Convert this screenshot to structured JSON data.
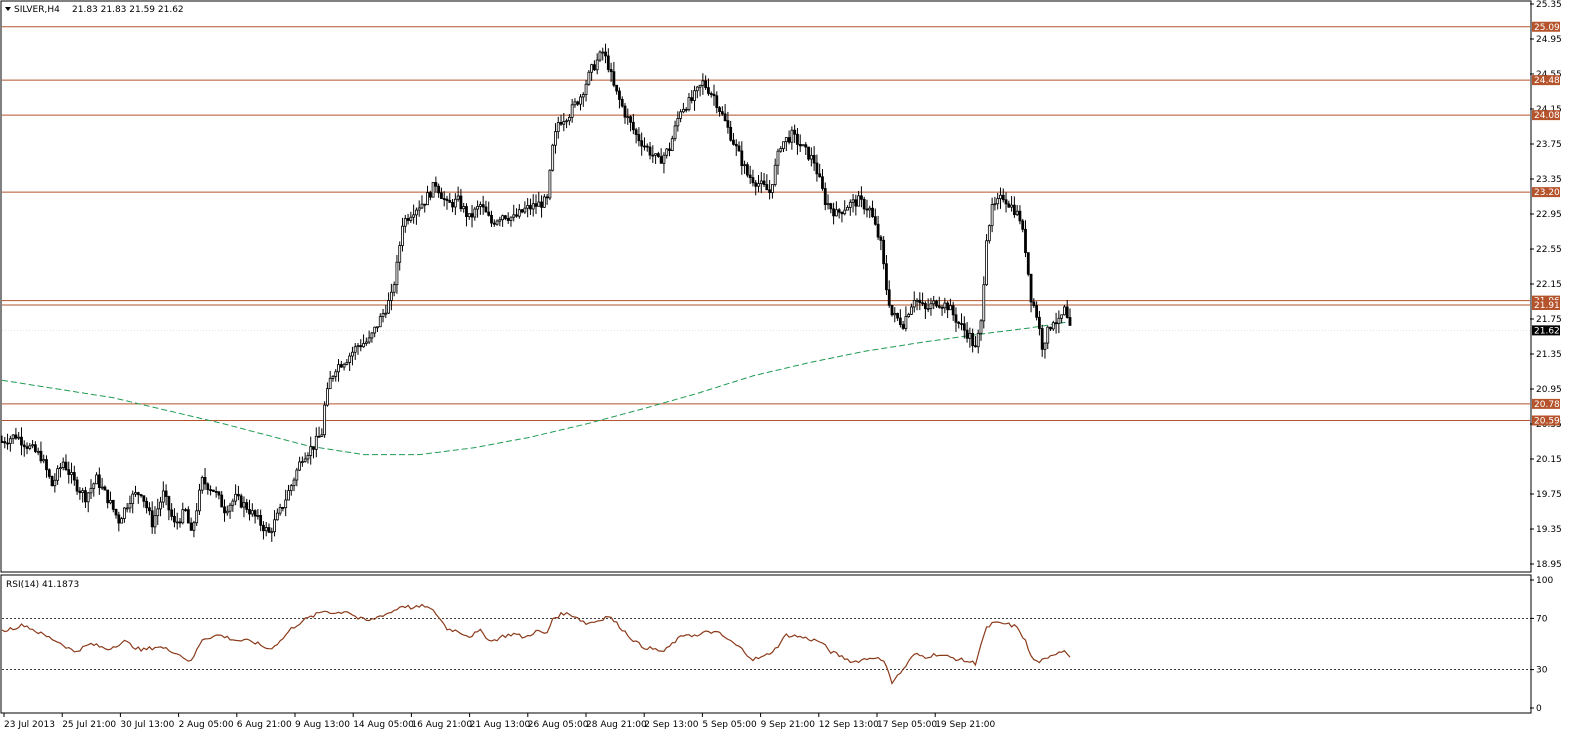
{
  "header": {
    "symbol_label": "SILVER,H4",
    "ohlc_label": "21.83 21.83 21.59 21.62",
    "menu_icon": "triangle-down-icon"
  },
  "colors": {
    "background": "#ffffff",
    "candle": "#000000",
    "level": "#b5532c",
    "badge": "#b5532c",
    "ma": "#1e9a52",
    "rsi": "#8b3a1a",
    "current_badge": "#000000"
  },
  "chart_data": [
    {
      "type": "candlestick",
      "title": "SILVER,H4",
      "subtitle": "21.83 21.83 21.59 21.62",
      "ylim": [
        18.95,
        25.35
      ],
      "y_ticks": [
        "25.35",
        "24.95",
        "24.55",
        "24.15",
        "23.75",
        "23.35",
        "22.95",
        "22.55",
        "22.15",
        "21.75",
        "21.35",
        "20.95",
        "20.55",
        "20.15",
        "19.75",
        "19.35",
        "18.95"
      ],
      "x_ticks": [
        "23 Jul 2013",
        "25 Jul 21:00",
        "30 Jul 13:00",
        "2 Aug 05:00",
        "6 Aug 21:00",
        "9 Aug 13:00",
        "14 Aug 05:00",
        "16 Aug 21:00",
        "21 Aug 13:00",
        "26 Aug 05:00",
        "28 Aug 21:00",
        "2 Sep 13:00",
        "5 Sep 05:00",
        "9 Sep 21:00",
        "12 Sep 13:00",
        "17 Sep 05:00",
        "19 Sep 21:00"
      ],
      "horizontal_levels": [
        25.09,
        24.48,
        24.08,
        23.2,
        21.96,
        21.91,
        20.78,
        20.59
      ],
      "level_labels": [
        "25.09",
        "24.48",
        "24.08",
        "23.20",
        "21.96",
        "21.91",
        "20.78",
        "20.59"
      ],
      "current_price": 21.62,
      "current_price_label": "21.62",
      "close_path": [
        [
          0,
          20.35
        ],
        [
          5,
          20.42
        ],
        [
          10,
          20.28
        ],
        [
          14,
          20.18
        ],
        [
          18,
          19.85
        ],
        [
          22,
          20.12
        ],
        [
          26,
          19.88
        ],
        [
          30,
          19.72
        ],
        [
          34,
          19.92
        ],
        [
          38,
          19.7
        ],
        [
          42,
          19.45
        ],
        [
          46,
          19.7
        ],
        [
          50,
          19.78
        ],
        [
          54,
          19.42
        ],
        [
          58,
          19.75
        ],
        [
          62,
          19.4
        ],
        [
          66,
          19.55
        ],
        [
          68,
          19.28
        ],
        [
          72,
          19.9
        ],
        [
          76,
          19.8
        ],
        [
          80,
          19.58
        ],
        [
          84,
          19.7
        ],
        [
          88,
          19.6
        ],
        [
          92,
          19.45
        ],
        [
          96,
          19.3
        ],
        [
          100,
          19.55
        ],
        [
          104,
          19.85
        ],
        [
          108,
          20.18
        ],
        [
          112,
          20.3
        ],
        [
          115,
          20.45
        ],
        [
          116,
          20.75
        ],
        [
          118,
          21.05
        ],
        [
          120,
          21.2
        ],
        [
          124,
          21.3
        ],
        [
          128,
          21.45
        ],
        [
          132,
          21.5
        ],
        [
          136,
          21.75
        ],
        [
          140,
          22.0
        ],
        [
          142,
          22.35
        ],
        [
          144,
          22.85
        ],
        [
          148,
          23.0
        ],
        [
          152,
          23.1
        ],
        [
          156,
          23.3
        ],
        [
          160,
          23.05
        ],
        [
          164,
          23.1
        ],
        [
          168,
          22.9
        ],
        [
          172,
          23.05
        ],
        [
          176,
          22.85
        ],
        [
          180,
          22.95
        ],
        [
          184,
          22.9
        ],
        [
          188,
          23.0
        ],
        [
          192,
          23.05
        ],
        [
          196,
          23.1
        ],
        [
          198,
          23.7
        ],
        [
          200,
          24.0
        ],
        [
          204,
          24.1
        ],
        [
          208,
          24.3
        ],
        [
          212,
          24.6
        ],
        [
          216,
          24.8
        ],
        [
          218,
          24.65
        ],
        [
          220,
          24.4
        ],
        [
          224,
          24.1
        ],
        [
          228,
          23.85
        ],
        [
          232,
          23.7
        ],
        [
          236,
          23.55
        ],
        [
          240,
          23.7
        ],
        [
          244,
          24.15
        ],
        [
          248,
          24.25
        ],
        [
          252,
          24.45
        ],
        [
          256,
          24.3
        ],
        [
          260,
          24.0
        ],
        [
          264,
          23.7
        ],
        [
          268,
          23.4
        ],
        [
          272,
          23.3
        ],
        [
          276,
          23.2
        ],
        [
          280,
          23.75
        ],
        [
          284,
          23.85
        ],
        [
          288,
          23.7
        ],
        [
          292,
          23.55
        ],
        [
          296,
          23.1
        ],
        [
          300,
          22.95
        ],
        [
          304,
          23.05
        ],
        [
          308,
          23.1
        ],
        [
          312,
          23.0
        ],
        [
          316,
          22.6
        ],
        [
          318,
          22.1
        ],
        [
          320,
          21.8
        ],
        [
          324,
          21.7
        ],
        [
          328,
          22.0
        ],
        [
          332,
          21.85
        ],
        [
          336,
          21.95
        ],
        [
          340,
          21.9
        ],
        [
          344,
          21.7
        ],
        [
          348,
          21.55
        ],
        [
          350,
          21.4
        ],
        [
          352,
          21.7
        ],
        [
          354,
          22.7
        ],
        [
          356,
          23.0
        ],
        [
          360,
          23.15
        ],
        [
          364,
          23.0
        ],
        [
          366,
          22.9
        ],
        [
          368,
          22.55
        ],
        [
          370,
          22.0
        ],
        [
          372,
          21.8
        ],
        [
          374,
          21.45
        ],
        [
          376,
          21.6
        ],
        [
          378,
          21.75
        ],
        [
          380,
          21.7
        ],
        [
          382,
          21.85
        ],
        [
          384,
          21.62
        ]
      ],
      "moving_average_path": [
        [
          0,
          21.05
        ],
        [
          40,
          20.85
        ],
        [
          80,
          20.55
        ],
        [
          110,
          20.3
        ],
        [
          130,
          20.2
        ],
        [
          150,
          20.2
        ],
        [
          170,
          20.28
        ],
        [
          190,
          20.4
        ],
        [
          210,
          20.55
        ],
        [
          230,
          20.72
        ],
        [
          250,
          20.9
        ],
        [
          270,
          21.1
        ],
        [
          290,
          21.25
        ],
        [
          310,
          21.38
        ],
        [
          330,
          21.48
        ],
        [
          350,
          21.57
        ],
        [
          370,
          21.65
        ],
        [
          384,
          21.72
        ]
      ]
    },
    {
      "type": "line",
      "title": "RSI(14) 41.1873",
      "ylim": [
        0,
        100
      ],
      "y_ticks": [
        "100",
        "70",
        "30",
        "0"
      ],
      "reference_levels": [
        70,
        30
      ],
      "series": [
        {
          "name": "RSI(14)",
          "values": [
            [
              0,
              60
            ],
            [
              8,
              65
            ],
            [
              14,
              58
            ],
            [
              20,
              52
            ],
            [
              26,
              44
            ],
            [
              32,
              50
            ],
            [
              38,
              46
            ],
            [
              44,
              52
            ],
            [
              50,
              45
            ],
            [
              56,
              48
            ],
            [
              62,
              44
            ],
            [
              68,
              36
            ],
            [
              72,
              54
            ],
            [
              78,
              57
            ],
            [
              84,
              53
            ],
            [
              90,
              52
            ],
            [
              96,
              46
            ],
            [
              100,
              52
            ],
            [
              104,
              62
            ],
            [
              108,
              68
            ],
            [
              112,
              72
            ],
            [
              116,
              76
            ],
            [
              120,
              74
            ],
            [
              124,
              76
            ],
            [
              128,
              70
            ],
            [
              132,
              68
            ],
            [
              136,
              72
            ],
            [
              140,
              75
            ],
            [
              144,
              80
            ],
            [
              148,
              78
            ],
            [
              152,
              80
            ],
            [
              156,
              74
            ],
            [
              160,
              62
            ],
            [
              164,
              60
            ],
            [
              168,
              56
            ],
            [
              172,
              60
            ],
            [
              176,
              52
            ],
            [
              180,
              56
            ],
            [
              184,
              58
            ],
            [
              188,
              55
            ],
            [
              192,
              60
            ],
            [
              196,
              58
            ],
            [
              198,
              70
            ],
            [
              202,
              74
            ],
            [
              206,
              72
            ],
            [
              210,
              66
            ],
            [
              214,
              68
            ],
            [
              218,
              72
            ],
            [
              222,
              64
            ],
            [
              226,
              55
            ],
            [
              230,
              48
            ],
            [
              234,
              46
            ],
            [
              238,
              44
            ],
            [
              242,
              52
            ],
            [
              246,
              58
            ],
            [
              250,
              56
            ],
            [
              254,
              60
            ],
            [
              258,
              58
            ],
            [
              262,
              52
            ],
            [
              266,
              46
            ],
            [
              270,
              38
            ],
            [
              274,
              40
            ],
            [
              278,
              46
            ],
            [
              282,
              57
            ],
            [
              286,
              56
            ],
            [
              290,
              54
            ],
            [
              294,
              52
            ],
            [
              298,
              44
            ],
            [
              302,
              40
            ],
            [
              306,
              36
            ],
            [
              310,
              38
            ],
            [
              314,
              40
            ],
            [
              318,
              34
            ],
            [
              320,
              20
            ],
            [
              324,
              30
            ],
            [
              328,
              42
            ],
            [
              332,
              40
            ],
            [
              336,
              42
            ],
            [
              340,
              40
            ],
            [
              344,
              38
            ],
            [
              348,
              36
            ],
            [
              350,
              35
            ],
            [
              352,
              50
            ],
            [
              354,
              62
            ],
            [
              356,
              66
            ],
            [
              360,
              66
            ],
            [
              364,
              64
            ],
            [
              366,
              60
            ],
            [
              368,
              52
            ],
            [
              370,
              40
            ],
            [
              372,
              36
            ],
            [
              376,
              38
            ],
            [
              378,
              42
            ],
            [
              380,
              44
            ],
            [
              382,
              45
            ],
            [
              384,
              41
            ]
          ]
        }
      ]
    }
  ]
}
